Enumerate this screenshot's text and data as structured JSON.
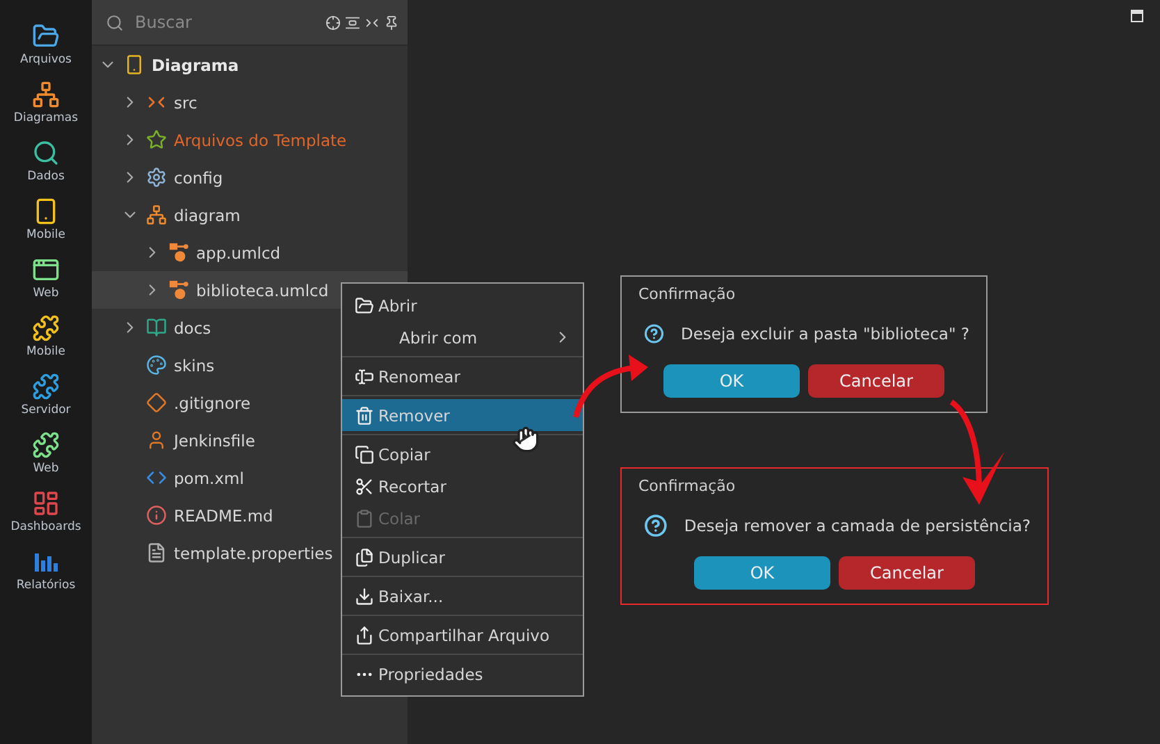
{
  "nav": [
    {
      "label": "Arquivos",
      "kind": "files"
    },
    {
      "label": "Diagramas",
      "kind": "diagrams"
    },
    {
      "label": "Dados",
      "kind": "data"
    },
    {
      "label": "Mobile",
      "kind": "phone"
    },
    {
      "label": "Web",
      "kind": "browser"
    },
    {
      "label": "Mobile",
      "kind": "puzzle-mobile"
    },
    {
      "label": "Servidor",
      "kind": "puzzle-server"
    },
    {
      "label": "Web",
      "kind": "puzzle-web"
    },
    {
      "label": "Dashboards",
      "kind": "dashboards"
    },
    {
      "label": "Relatórios",
      "kind": "reports"
    }
  ],
  "search": {
    "placeholder": "Buscar"
  },
  "tree": [
    {
      "label": "Diagrama",
      "kind": "project",
      "expanded": true,
      "selected": false,
      "color": "#e8e8e8",
      "children": [
        {
          "label": "src",
          "kind": "source",
          "expanded": false,
          "selected": false,
          "color": "#d8d8d8"
        },
        {
          "label": "Arquivos do Template",
          "kind": "template",
          "expanded": false,
          "selected": false,
          "color": "#e0662a"
        },
        {
          "label": "config",
          "kind": "config",
          "expanded": false,
          "selected": false,
          "color": "#d8d8d8"
        },
        {
          "label": "diagram",
          "kind": "diagram",
          "expanded": true,
          "selected": false,
          "color": "#d8d8d8",
          "children": [
            {
              "label": "app.umlcd",
              "kind": "uml",
              "expanded": false,
              "selected": false,
              "color": "#d8d8d8"
            },
            {
              "label": "biblioteca.umlcd",
              "kind": "uml",
              "expanded": false,
              "selected": true,
              "color": "#d8d8d8"
            }
          ]
        },
        {
          "label": "docs",
          "kind": "docs",
          "expanded": false,
          "selected": false,
          "color": "#d8d8d8"
        },
        {
          "label": "skins",
          "kind": "skins",
          "selected": false,
          "color": "#d8d8d8"
        },
        {
          "label": ".gitignore",
          "kind": "git",
          "selected": false,
          "color": "#d8d8d8"
        },
        {
          "label": "Jenkinsfile",
          "kind": "jenkins",
          "selected": false,
          "color": "#d8d8d8"
        },
        {
          "label": "pom.xml",
          "kind": "xml",
          "selected": false,
          "color": "#d8d8d8"
        },
        {
          "label": "README.md",
          "kind": "readme",
          "selected": false,
          "color": "#d8d8d8"
        },
        {
          "label": "template.properties",
          "kind": "properties",
          "selected": false,
          "color": "#d8d8d8"
        }
      ]
    }
  ],
  "context_menu": {
    "groups": [
      [
        {
          "label": "Abrir",
          "kind": "open",
          "selected": false,
          "disabled": false
        },
        {
          "label": "Abrir com",
          "kind": "open-with",
          "selected": false,
          "disabled": false,
          "submenu": true
        }
      ],
      [
        {
          "label": "Renomear",
          "kind": "rename",
          "selected": false,
          "disabled": false
        }
      ],
      [
        {
          "label": "Remover",
          "kind": "remove",
          "selected": true,
          "disabled": false
        }
      ],
      [
        {
          "label": "Copiar",
          "kind": "copy",
          "selected": false,
          "disabled": false
        },
        {
          "label": "Recortar",
          "kind": "cut",
          "selected": false,
          "disabled": false
        },
        {
          "label": "Colar",
          "kind": "paste",
          "selected": false,
          "disabled": true
        }
      ],
      [
        {
          "label": "Duplicar",
          "kind": "duplicate",
          "selected": false,
          "disabled": false
        }
      ],
      [
        {
          "label": "Baixar...",
          "kind": "download",
          "selected": false,
          "disabled": false
        }
      ],
      [
        {
          "label": "Compartilhar Arquivo",
          "kind": "share",
          "selected": false,
          "disabled": false
        }
      ],
      [
        {
          "label": "Propriedades",
          "kind": "properties",
          "selected": false,
          "disabled": false
        }
      ]
    ]
  },
  "dialogs": [
    {
      "title": "Confirmação",
      "message": "Deseja excluir a pasta \"biblioteca\" ?",
      "highlighted": false,
      "buttons": [
        {
          "label": "OK",
          "kind": "ok"
        },
        {
          "label": "Cancelar",
          "kind": "cancel"
        }
      ]
    },
    {
      "title": "Confirmação",
      "message": "Deseja remover a camada de persistência?",
      "highlighted": true,
      "buttons": [
        {
          "label": "OK",
          "kind": "ok"
        },
        {
          "label": "Cancelar",
          "kind": "cancel"
        }
      ]
    }
  ]
}
